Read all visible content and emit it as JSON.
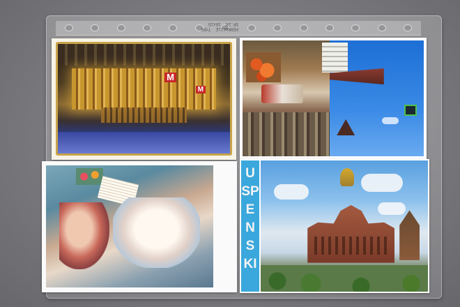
{
  "sleeve": {
    "strip_text": "PERMAFILE  TYPE\nSP.28  10x15"
  },
  "cards": {
    "top_left": {
      "sign_letter": "M",
      "sign_letter_2": "M"
    },
    "bottom_right": {
      "banner": "USPENSKI"
    }
  },
  "colors": {
    "background": "#7a7a7e",
    "gold_frame": "#c9a44a",
    "banner_blue": "#3aa8dc"
  }
}
